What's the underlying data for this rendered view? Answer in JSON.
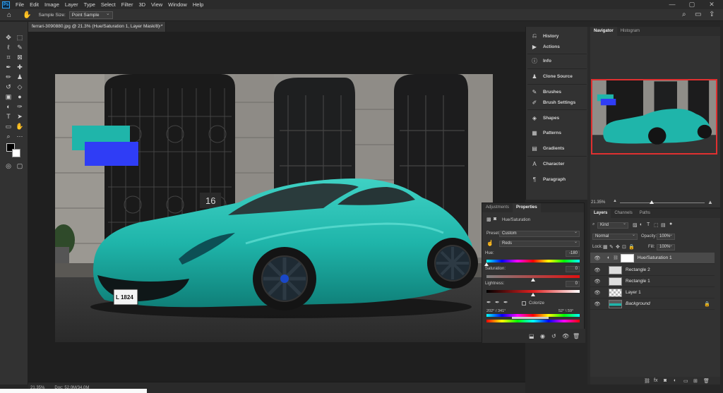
{
  "menubar": {
    "logo": "Ps",
    "items": [
      "File",
      "Edit",
      "Image",
      "Layer",
      "Type",
      "Select",
      "Filter",
      "3D",
      "View",
      "Window",
      "Help"
    ],
    "min": "—",
    "max": "▢",
    "close": "✕"
  },
  "options": {
    "sample_size_label": "Sample Size:",
    "sample_size_value": "Point Sample"
  },
  "document": {
    "tab_title": "ferrari-3090880.jpg @ 21.3% (Hue/Saturation 1, Layer Mask/8) *",
    "close": "×",
    "door_number": "16",
    "plate_text": "L 1824"
  },
  "status": {
    "zoom": "21.35%",
    "doc_size": "Doc: 52.0M/34.0M"
  },
  "panel_column": {
    "items": [
      {
        "label": "History",
        "icon": "history-icon"
      },
      {
        "label": "Actions",
        "icon": "actions-icon"
      },
      {
        "label": "Info",
        "icon": "info-icon"
      },
      {
        "label": "Clone Source",
        "icon": "clone-source-icon"
      },
      {
        "label": "Brushes",
        "icon": "brushes-icon"
      },
      {
        "label": "Brush Settings",
        "icon": "brush-settings-icon"
      },
      {
        "label": "Shapes",
        "icon": "shapes-icon"
      },
      {
        "label": "Patterns",
        "icon": "patterns-icon"
      },
      {
        "label": "Gradients",
        "icon": "gradients-icon"
      },
      {
        "label": "Character",
        "icon": "character-icon"
      },
      {
        "label": "Paragraph",
        "icon": "paragraph-icon"
      }
    ]
  },
  "navigator": {
    "tabs": [
      "Navigator",
      "Histogram"
    ],
    "zoom": "21.35%"
  },
  "properties": {
    "tabs": [
      "Adjustments",
      "Properties"
    ],
    "title": "Hue/Saturation",
    "preset_label": "Preset:",
    "preset_value": "Custom",
    "channel_value": "Reds",
    "hue_label": "Hue:",
    "hue_value": "-180",
    "hue_level": 0.0,
    "saturation_label": "Saturation:",
    "saturation_value": "0",
    "saturation_level": 0.5,
    "lightness_label": "Lightness:",
    "lightness_value": "0",
    "lightness_level": 0.5,
    "colorize_label": "Colorize",
    "range_left": "202° / 341°",
    "range_right": "52° \\ 59°"
  },
  "layers": {
    "tabs": [
      "Layers",
      "Channels",
      "Paths"
    ],
    "filter_kind": "Kind",
    "blend_mode": "Normal",
    "opacity_label": "Opacity:",
    "opacity_value": "100%",
    "lock_label": "Lock:",
    "fill_label": "Fill:",
    "fill_value": "100%",
    "items": [
      {
        "name": "Hue/Saturation 1"
      },
      {
        "name": "Rectangle 2"
      },
      {
        "name": "Rectangle 1"
      },
      {
        "name": "Layer 1"
      },
      {
        "name": "Background"
      }
    ]
  },
  "colors": {
    "teal": "#1fb5aa",
    "blue": "#2f3df6",
    "accent_red": "#e03030"
  }
}
